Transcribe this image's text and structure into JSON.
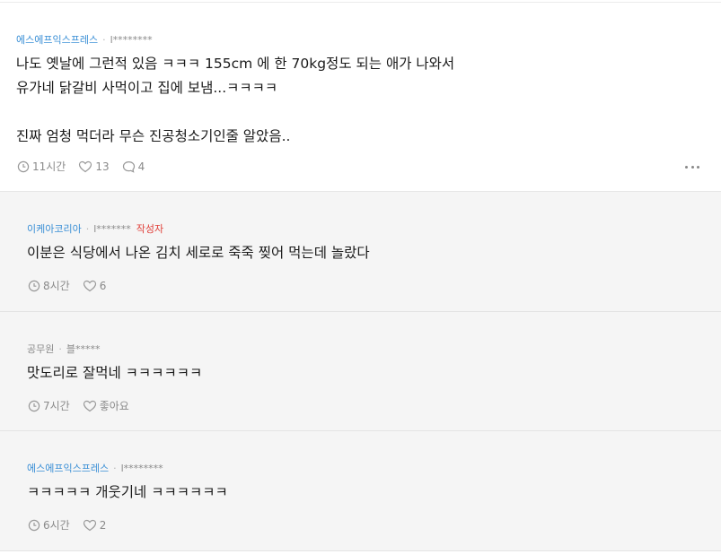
{
  "comments": [
    {
      "company": "에스에프익스프레스",
      "nickname": "l********",
      "lines": [
        "나도 옛날에 그런적 있음 ㅋㅋㅋ 155cm 에 한 70kg정도 되는 애가 나와서",
        "유가네 닭갈비 사먹이고 집에 보냄...ㅋㅋㅋㅋ",
        "",
        "진짜 엄청 먹더라 무슨 진공청소기인줄 알았음.."
      ],
      "time": "11시간",
      "likes": "13",
      "replies": "4"
    },
    {
      "company": "이케아코리아",
      "nickname": "l*******",
      "author_tag": "작성자",
      "text": "이분은 식당에서 나온 김치 세로로 죽죽 찢어 먹는데 놀랐다",
      "time": "8시간",
      "likes": "6"
    },
    {
      "company": "공무원",
      "nickname": "블*****",
      "text": "맛도리로 잘먹네 ㅋㅋㅋㅋㅋㅋ",
      "time": "7시간",
      "likes": "좋아요"
    },
    {
      "company": "에스에프익스프레스",
      "nickname": "l********",
      "text": "ㅋㅋㅋㅋㅋ 개웃기네 ㅋㅋㅋㅋㅋㅋ",
      "time": "6시간",
      "likes": "2"
    }
  ],
  "separator": "·",
  "icons": [
    "clock-icon",
    "heart-icon",
    "comment-bubble-icon",
    "more-dots-icon"
  ],
  "colors": {
    "company_link": "#3a8fd6",
    "author_tag": "#e0403a",
    "reply_bg": "#f5f5f5"
  }
}
